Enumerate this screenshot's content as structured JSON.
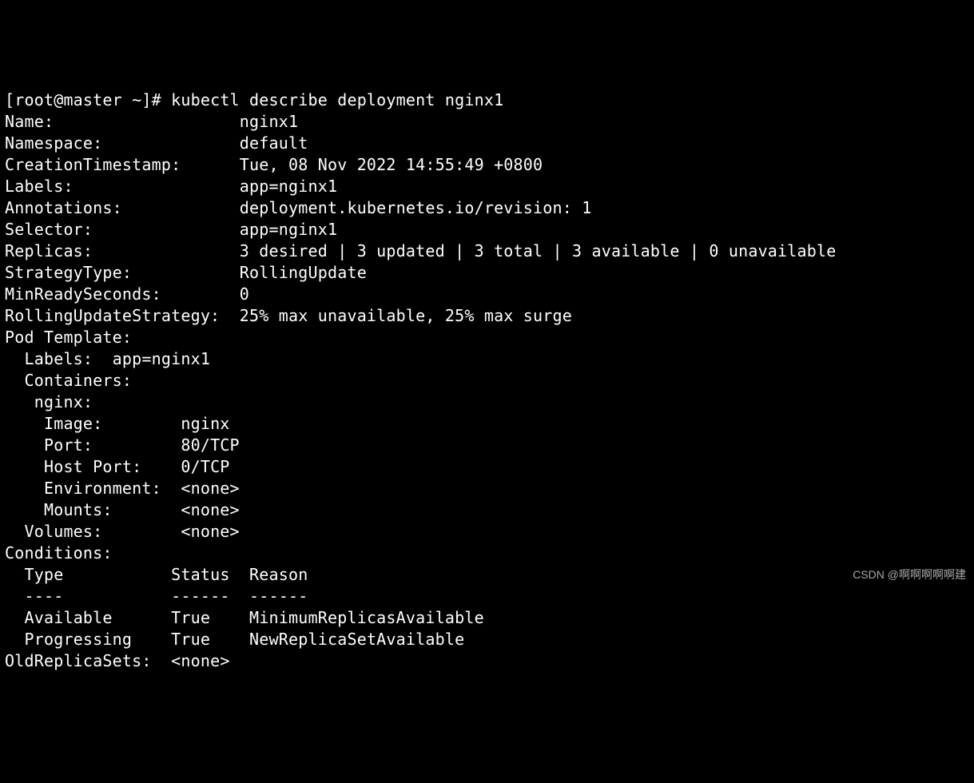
{
  "prompt": "[root@master ~]# ",
  "command": "kubectl describe deployment nginx1",
  "describe": {
    "Name": "nginx1",
    "Namespace": "default",
    "CreationTimestamp": "Tue, 08 Nov 2022 14:55:49 +0800",
    "Labels": "app=nginx1",
    "Annotations": "deployment.kubernetes.io/revision: 1",
    "Selector": "app=nginx1",
    "Replicas": "3 desired | 3 updated | 3 total | 3 available | 0 unavailable",
    "StrategyType": "RollingUpdate",
    "MinReadySeconds": "0",
    "RollingUpdateStrategy": "25% max unavailable, 25% max surge"
  },
  "podTemplate": {
    "header": "Pod Template:",
    "Labels": "app=nginx1",
    "ContainersHeader": "Containers:",
    "containerName": "nginx:",
    "Image": "nginx",
    "Port": "80/TCP",
    "HostPort": "0/TCP",
    "Environment": "<none>",
    "Mounts": "<none>",
    "Volumes": "<none>"
  },
  "conditions": {
    "header": "Conditions:",
    "columns": {
      "Type": "Type",
      "Status": "Status",
      "Reason": "Reason"
    },
    "divider": {
      "Type": "----",
      "Status": "------",
      "Reason": "------"
    },
    "rows": [
      {
        "Type": "Available",
        "Status": "True",
        "Reason": "MinimumReplicasAvailable"
      },
      {
        "Type": "Progressing",
        "Status": "True",
        "Reason": "NewReplicaSetAvailable"
      }
    ]
  },
  "OldReplicaSets": "<none>",
  "watermark": "CSDN @啊啊啊啊啊建"
}
